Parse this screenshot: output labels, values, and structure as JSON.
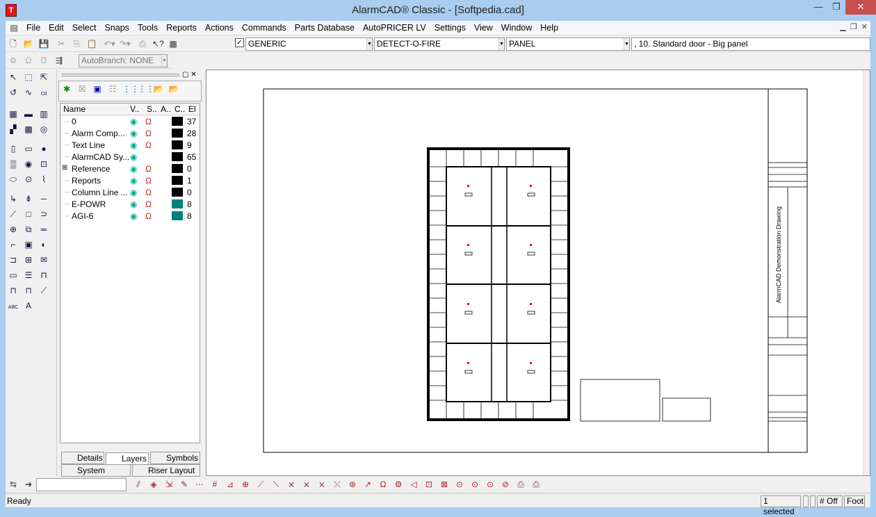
{
  "window": {
    "title": "AlarmCAD® Classic - [Softpedia.cad]",
    "min": "—",
    "max": "❐",
    "close": "✕"
  },
  "menu": [
    "File",
    "Edit",
    "Select",
    "Snaps",
    "Tools",
    "Reports",
    "Actions",
    "Commands",
    "Parts Database",
    "AutoPRICER LV",
    "Settings",
    "View",
    "Window",
    "Help"
  ],
  "toolbar": {
    "combo1": "GENERIC",
    "combo2": "DETECT-O-FIRE",
    "combo3": "PANEL",
    "part": ", 10. Standard door - Big panel",
    "autobranch": "AutoBranch: NONE",
    "check": "✓"
  },
  "layers": {
    "columns": [
      "Name",
      "V..",
      "S..",
      "A..",
      "C..",
      "El"
    ],
    "rows": [
      {
        "name": "0",
        "visible": true,
        "snap": true,
        "color": "#000000",
        "count": "37"
      },
      {
        "name": "Alarm Comp...",
        "visible": true,
        "snap": true,
        "color": "#000000",
        "count": "28"
      },
      {
        "name": "Text Line",
        "visible": true,
        "snap": true,
        "color": "#000000",
        "count": "9"
      },
      {
        "name": "AlarmCAD Sy...",
        "visible": true,
        "snap": false,
        "color": "#000000",
        "count": "65"
      },
      {
        "name": "Reference",
        "visible": true,
        "snap": true,
        "color": "#000000",
        "count": "0",
        "expandable": true
      },
      {
        "name": "Reports",
        "visible": true,
        "snap": true,
        "color": "#000000",
        "count": "1"
      },
      {
        "name": "Column Line ...",
        "visible": true,
        "snap": true,
        "color": "#000000",
        "count": "0"
      },
      {
        "name": "E-POWR",
        "visible": true,
        "snap": true,
        "color": "#008080",
        "count": "8"
      },
      {
        "name": "AGI-6",
        "visible": true,
        "snap": true,
        "color": "#008080",
        "count": "8"
      }
    ],
    "tabs": [
      "Details",
      "Layers",
      "Symbols"
    ],
    "tabs2": [
      "System Layout",
      "Riser Layout"
    ],
    "active_tab": "Layers"
  },
  "drawing": {
    "title_block": "AlarmCAD Demonstration Drawing"
  },
  "status": {
    "ready": "Ready",
    "selected": "1 selected",
    "grid": "# Off",
    "units": "Foot"
  },
  "palette_icons": [
    "pointer",
    "select-window",
    "select-move",
    "rotate",
    "wire",
    "ctrl",
    "panel",
    "device",
    "detector",
    "strobe",
    "pull",
    "smoke",
    "horn",
    "bell",
    "line",
    "arc",
    "rect",
    "circle",
    "text-abc",
    "text-A"
  ]
}
